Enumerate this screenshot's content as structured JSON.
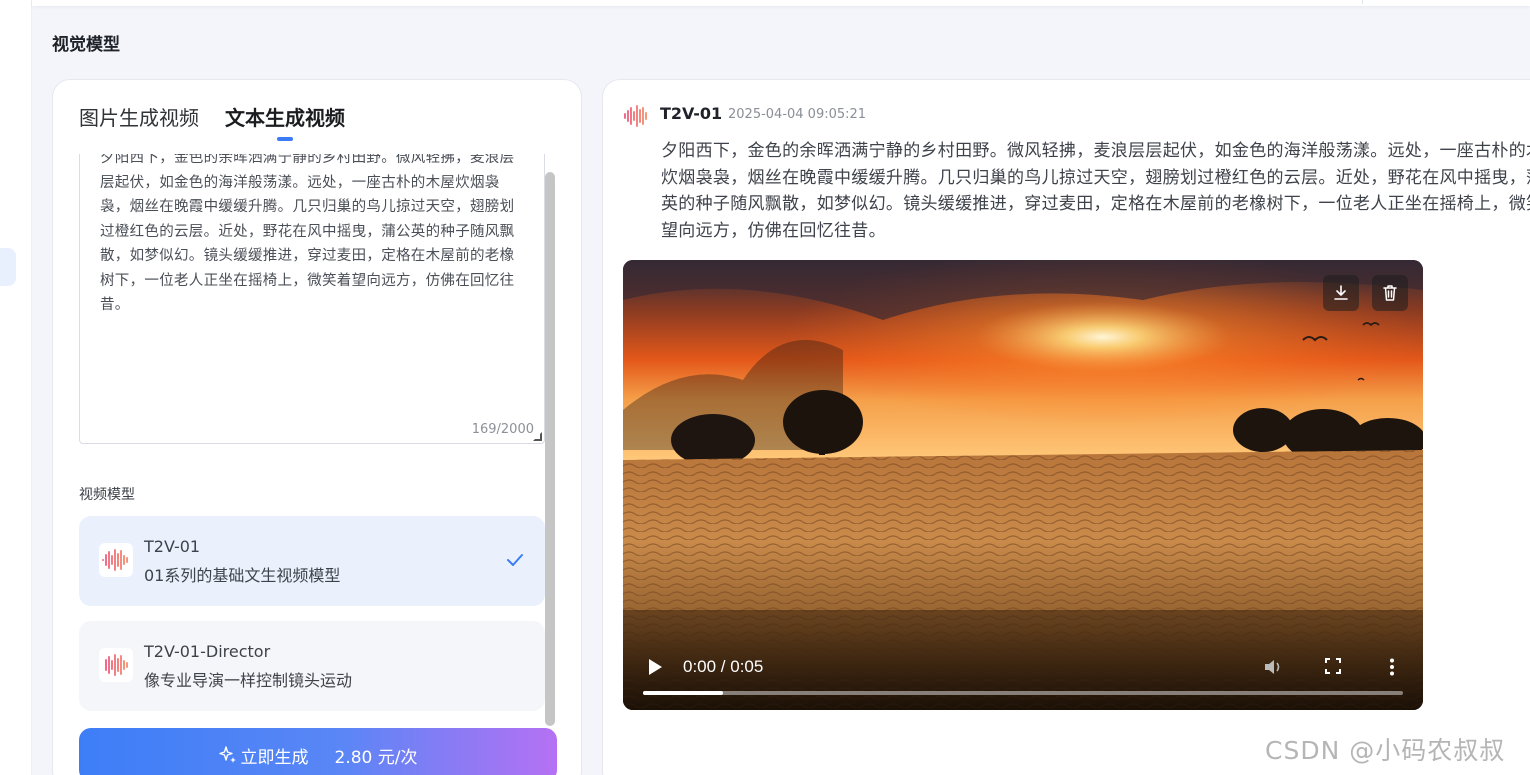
{
  "page": {
    "title": "视觉模型"
  },
  "tabs": [
    {
      "label": "图片生成视频",
      "active": false
    },
    {
      "label": "文本生成视频",
      "active": true
    }
  ],
  "prompt": {
    "text": "夕阳西下，金色的余晖洒满宁静的乡村田野。微风轻拂，麦浪层层起伏，如金色的海洋般荡漾。远处，一座古朴的木屋炊烟袅袅，烟丝在晚霞中缓缓升腾。几只归巢的鸟儿掠过天空，翅膀划过橙红色的云层。近处，野花在风中摇曳，蒲公英的种子随风飘散，如梦似幻。镜头缓缓推进，穿过麦田，定格在木屋前的老橡树下，一位老人正坐在摇椅上，微笑着望向远方，仿佛在回忆往昔。",
    "count": "169/2000"
  },
  "model_section": {
    "label": "视频模型",
    "models": [
      {
        "name": "T2V-01",
        "desc": "01系列的基础文生视频模型",
        "selected": true,
        "icon": "waveform-icon"
      },
      {
        "name": "T2V-01-Director",
        "desc": "像专业导演一样控制镜头运动",
        "selected": false,
        "icon": "waveform-icon"
      }
    ]
  },
  "generate": {
    "label": "立即生成",
    "price": "2.80 元/次",
    "icon": "sparkle-icon"
  },
  "result": {
    "model": "T2V-01",
    "time": "2025-04-04 09:05:21",
    "text": "夕阳西下，金色的余晖洒满宁静的乡村田野。微风轻拂，麦浪层层起伏，如金色的海洋般荡漾。远处，一座古朴的木屋炊烟袅袅，烟丝在晚霞中缓缓升腾。几只归巢的鸟儿掠过天空，翅膀划过橙红色的云层。近处，野花在风中摇曳，蒲公英的种子随风飘散，如梦似幻。镜头缓缓推进，穿过麦田，定格在木屋前的老橡树下，一位老人正坐在摇椅上，微笑着望向远方，仿佛在回忆往昔。"
  },
  "video": {
    "time": "0:00 / 0:05",
    "progress": 0.105,
    "actions": [
      "download-icon",
      "trash-icon"
    ]
  },
  "watermark": "CSDN @小码农叔叔",
  "colors": {
    "accent": "#3b7cf6",
    "button_start": "#3d7ef7",
    "button_end": "#b571f3",
    "selected_bg": "#eaf1fd"
  }
}
